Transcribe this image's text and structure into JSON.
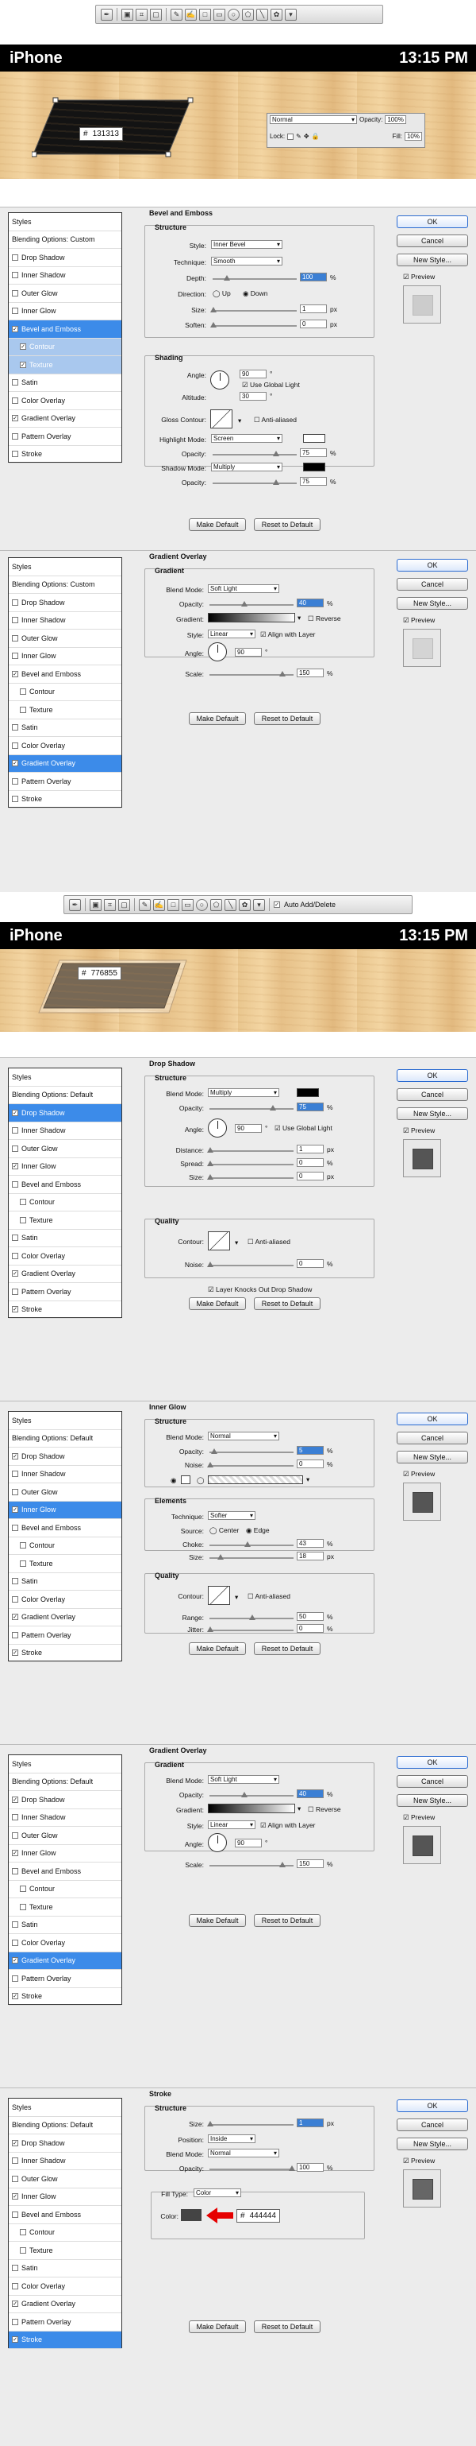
{
  "toolbar1": {
    "icons": [
      "pen-tool",
      "shape-layer",
      "paths",
      "fill-pixels",
      "pen",
      "freeform-pen",
      "rectangle",
      "rounded-rectangle",
      "ellipse",
      "polygon",
      "line",
      "custom-shape",
      "dropdown"
    ]
  },
  "toolbar2": {
    "icons": [
      "pen-tool",
      "shape-layer",
      "paths",
      "fill-pixels",
      "pen",
      "freeform-pen",
      "rectangle",
      "rounded-rectangle",
      "ellipse",
      "polygon",
      "line",
      "custom-shape",
      "dropdown"
    ],
    "checkbox_label": "Auto Add/Delete"
  },
  "phone1": {
    "title": "iPhone",
    "time": "13:15 PM",
    "color_prefix": "#",
    "color_value": "131313",
    "shape_color": "#131313",
    "layers": {
      "blend": "Normal",
      "opacity_label": "Opacity:",
      "opacity": "100%",
      "lock_label": "Lock:",
      "fill_label": "Fill:",
      "fill": "10%"
    }
  },
  "phone2": {
    "title": "iPhone",
    "time": "13:15 PM",
    "color_prefix": "#",
    "color_value": "776855",
    "shape_color": "#776855"
  },
  "common": {
    "ok": "OK",
    "cancel": "Cancel",
    "new_style": "New Style...",
    "preview": "Preview",
    "make_default": "Make Default",
    "reset_default": "Reset to Default",
    "px": "px",
    "pct": "%"
  },
  "p1": {
    "list": [
      "Styles",
      "Blending Options: Custom",
      "Drop Shadow",
      "Inner Shadow",
      "Outer Glow",
      "Inner Glow",
      "Bevel and Emboss",
      "Contour",
      "Texture",
      "Satin",
      "Color Overlay",
      "Gradient Overlay",
      "Pattern Overlay",
      "Stroke"
    ],
    "title": "Bevel and Emboss",
    "structure": "Structure",
    "style_label": "Style:",
    "style": "Inner Bevel",
    "technique_label": "Technique:",
    "technique": "Smooth",
    "depth_label": "Depth:",
    "depth": "100",
    "direction_label": "Direction:",
    "up": "Up",
    "down": "Down",
    "size_label": "Size:",
    "size": "1",
    "soften_label": "Soften:",
    "soften": "0",
    "shading": "Shading",
    "angle_label": "Angle:",
    "angle": "90",
    "global": "Use Global Light",
    "altitude_label": "Altitude:",
    "altitude": "30",
    "gloss_label": "Gloss Contour:",
    "anti": "Anti-aliased",
    "hl_label": "Highlight Mode:",
    "hl_mode": "Screen",
    "opacity_label": "Opacity:",
    "hl_op": "75",
    "sh_label": "Shadow Mode:",
    "sh_mode": "Multiply",
    "sh_op": "75"
  },
  "p2": {
    "list": [
      "Styles",
      "Blending Options: Custom",
      "Drop Shadow",
      "Inner Shadow",
      "Outer Glow",
      "Inner Glow",
      "Bevel and Emboss",
      "Contour",
      "Texture",
      "Satin",
      "Color Overlay",
      "Gradient Overlay",
      "Pattern Overlay",
      "Stroke"
    ],
    "title": "Gradient Overlay",
    "sub": "Gradient",
    "blend_label": "Blend Mode:",
    "blend": "Soft Light",
    "opacity_label": "Opacity:",
    "opacity": "40",
    "gradient_label": "Gradient:",
    "reverse": "Reverse",
    "style_label": "Style:",
    "style": "Linear",
    "align": "Align with Layer",
    "angle_label": "Angle:",
    "angle": "90",
    "scale_label": "Scale:",
    "scale": "150"
  },
  "p3": {
    "list": [
      "Styles",
      "Blending Options: Default",
      "Drop Shadow",
      "Inner Shadow",
      "Outer Glow",
      "Inner Glow",
      "Bevel and Emboss",
      "Contour",
      "Texture",
      "Satin",
      "Color Overlay",
      "Gradient Overlay",
      "Pattern Overlay",
      "Stroke"
    ],
    "title": "Drop Shadow",
    "structure": "Structure",
    "blend_label": "Blend Mode:",
    "blend": "Multiply",
    "opacity_label": "Opacity:",
    "opacity": "75",
    "angle_label": "Angle:",
    "angle": "90",
    "global": "Use Global Light",
    "distance_label": "Distance:",
    "distance": "1",
    "spread_label": "Spread:",
    "spread": "0",
    "size_label": "Size:",
    "size": "0",
    "quality": "Quality",
    "contour_label": "Contour:",
    "anti": "Anti-aliased",
    "noise_label": "Noise:",
    "noise": "0",
    "knock": "Layer Knocks Out Drop Shadow"
  },
  "p4": {
    "list": [
      "Styles",
      "Blending Options: Default",
      "Drop Shadow",
      "Inner Shadow",
      "Outer Glow",
      "Inner Glow",
      "Bevel and Emboss",
      "Contour",
      "Texture",
      "Satin",
      "Color Overlay",
      "Gradient Overlay",
      "Pattern Overlay",
      "Stroke"
    ],
    "title": "Inner Glow",
    "structure": "Structure",
    "blend_label": "Blend Mode:",
    "blend": "Normal",
    "opacity_label": "Opacity:",
    "opacity": "5",
    "noise_label": "Noise:",
    "noise": "0",
    "elements": "Elements",
    "technique_label": "Technique:",
    "technique": "Softer",
    "source_label": "Source:",
    "center": "Center",
    "edge": "Edge",
    "choke_label": "Choke:",
    "choke": "43",
    "size_label": "Size:",
    "size": "18",
    "quality": "Quality",
    "contour_label": "Contour:",
    "anti": "Anti-aliased",
    "range_label": "Range:",
    "range": "50",
    "jitter_label": "Jitter:",
    "jitter": "0"
  },
  "p5": {
    "list": [
      "Styles",
      "Blending Options: Default",
      "Drop Shadow",
      "Inner Shadow",
      "Outer Glow",
      "Inner Glow",
      "Bevel and Emboss",
      "Contour",
      "Texture",
      "Satin",
      "Color Overlay",
      "Gradient Overlay",
      "Pattern Overlay",
      "Stroke"
    ],
    "title": "Gradient Overlay",
    "sub": "Gradient",
    "blend_label": "Blend Mode:",
    "blend": "Soft Light",
    "opacity_label": "Opacity:",
    "opacity": "40",
    "gradient_label": "Gradient:",
    "reverse": "Reverse",
    "style_label": "Style:",
    "style": "Linear",
    "align": "Align with Layer",
    "angle_label": "Angle:",
    "angle": "90",
    "scale_label": "Scale:",
    "scale": "150"
  },
  "p6": {
    "list": [
      "Styles",
      "Blending Options: Default",
      "Drop Shadow",
      "Inner Shadow",
      "Outer Glow",
      "Inner Glow",
      "Bevel and Emboss",
      "Contour",
      "Texture",
      "Satin",
      "Color Overlay",
      "Gradient Overlay",
      "Pattern Overlay",
      "Stroke"
    ],
    "title": "Stroke",
    "structure": "Structure",
    "size_label": "Size:",
    "size": "1",
    "position_label": "Position:",
    "position": "Inside",
    "blend_label": "Blend Mode:",
    "blend": "Normal",
    "opacity_label": "Opacity:",
    "opacity": "100",
    "filltype_label": "Fill Type:",
    "filltype": "Color",
    "color_label": "Color:",
    "color_prefix": "#",
    "color_value": "444444",
    "stroke_color": "#444444"
  }
}
